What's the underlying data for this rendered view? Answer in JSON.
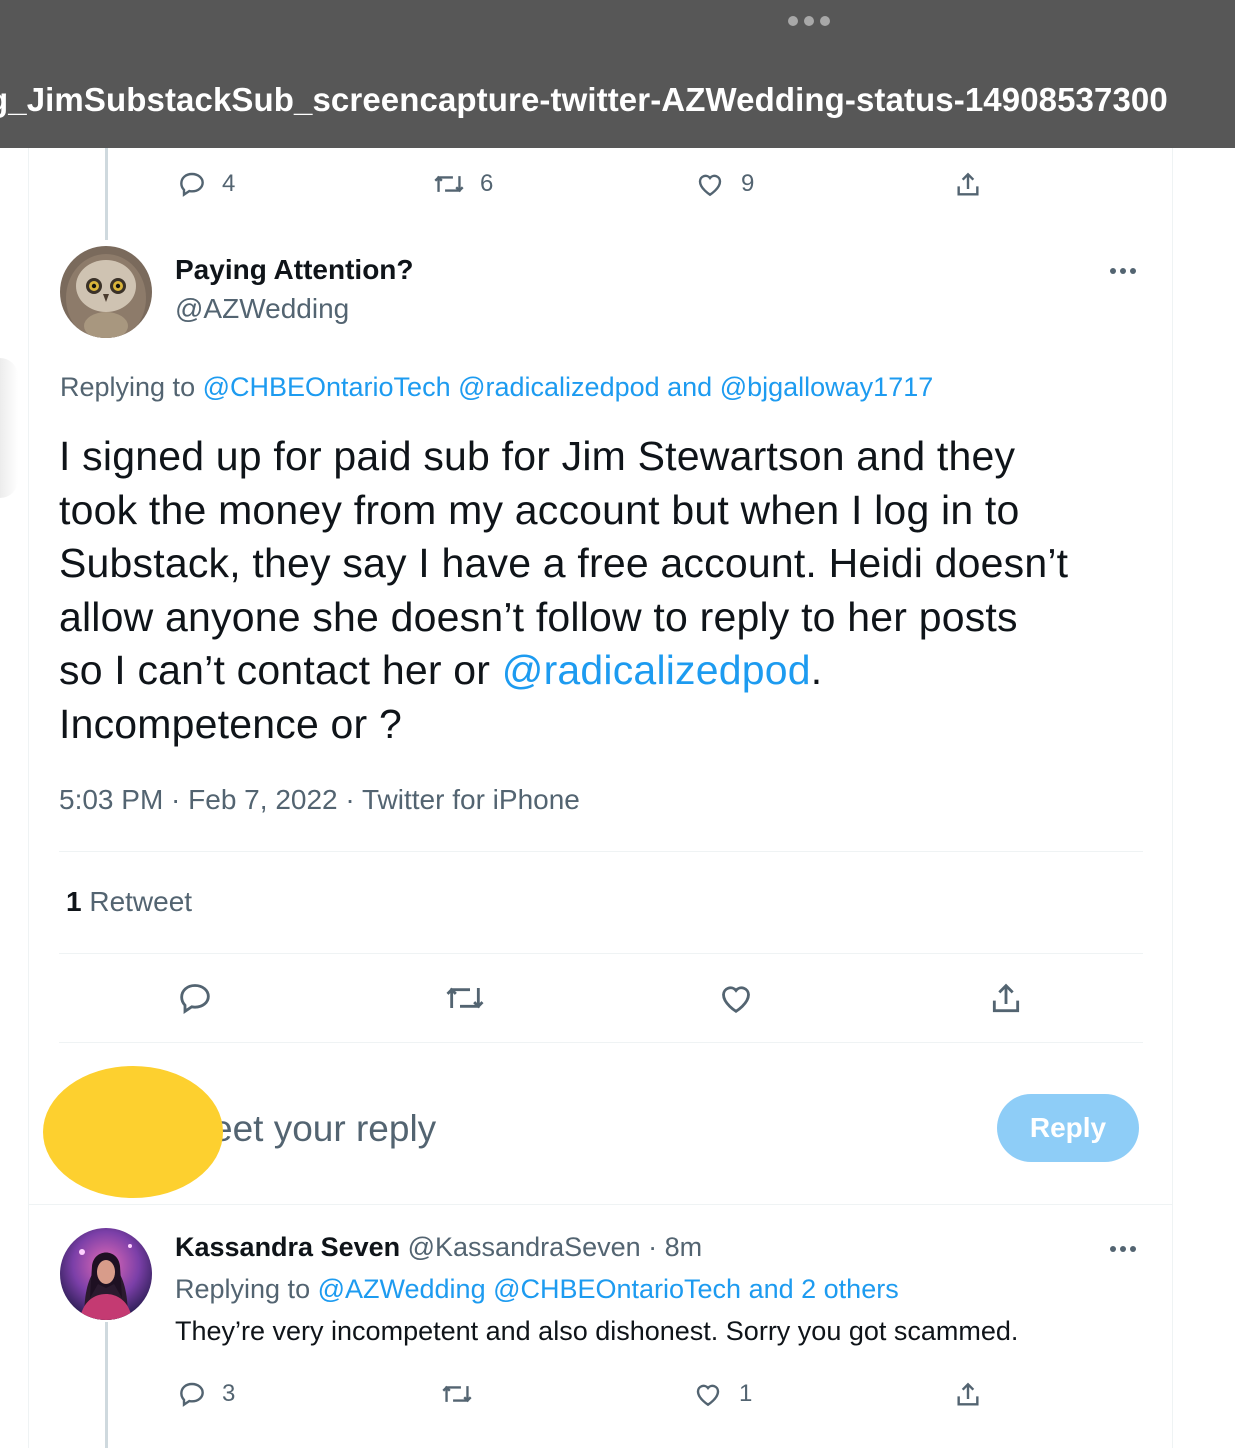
{
  "window": {
    "file_title": "g_JimSubstackSub_screencapture-twitter-AZWedding-status-14908537300"
  },
  "previous_tweet_actions": {
    "reply_count": "4",
    "retweet_count": "6",
    "like_count": "9"
  },
  "main_tweet": {
    "display_name": "Paying Attention?",
    "handle": "@AZWedding",
    "replying_prefix": "Replying to ",
    "replying_to": [
      "@CHBEOntarioTech",
      "@radicalizedpod"
    ],
    "replying_and": " and ",
    "replying_last": "@bjgalloway1717",
    "text_lines": [
      "I signed up for paid sub for Jim Stewartson and they",
      "took the money from my account but when I log in to",
      "Substack, they say I have a free account. Heidi doesn’t",
      "allow anyone she doesn’t follow to reply to her posts"
    ],
    "text_line5_before": "so I can’t contact her or ",
    "text_mention": "@radicalizedpod",
    "text_line5_after": ".",
    "text_line6": "Incompetence or ?",
    "meta": "5:03 PM · Feb 7, 2022 · Twitter for iPhone",
    "retweet_number": "1",
    "retweet_label": " Retweet"
  },
  "compose": {
    "placeholder": "eet your reply",
    "reply_button": "Reply"
  },
  "reply_tweet": {
    "display_name": "Kassandra Seven",
    "handle_time": " @KassandraSeven · 8m",
    "replying_prefix": "Replying to ",
    "replying_to": "@AZWedding @CHBEOntarioTech",
    "replying_and": " and ",
    "replying_others": "2 others",
    "text": "They’re very incompetent and also dishonest. Sorry you got scammed.",
    "reply_count": "3",
    "like_count": "1"
  },
  "colors": {
    "link": "#1d9bf0",
    "reply_button": "#8ecdf7",
    "redaction": "#fdd02f",
    "topbar": "#575757"
  }
}
